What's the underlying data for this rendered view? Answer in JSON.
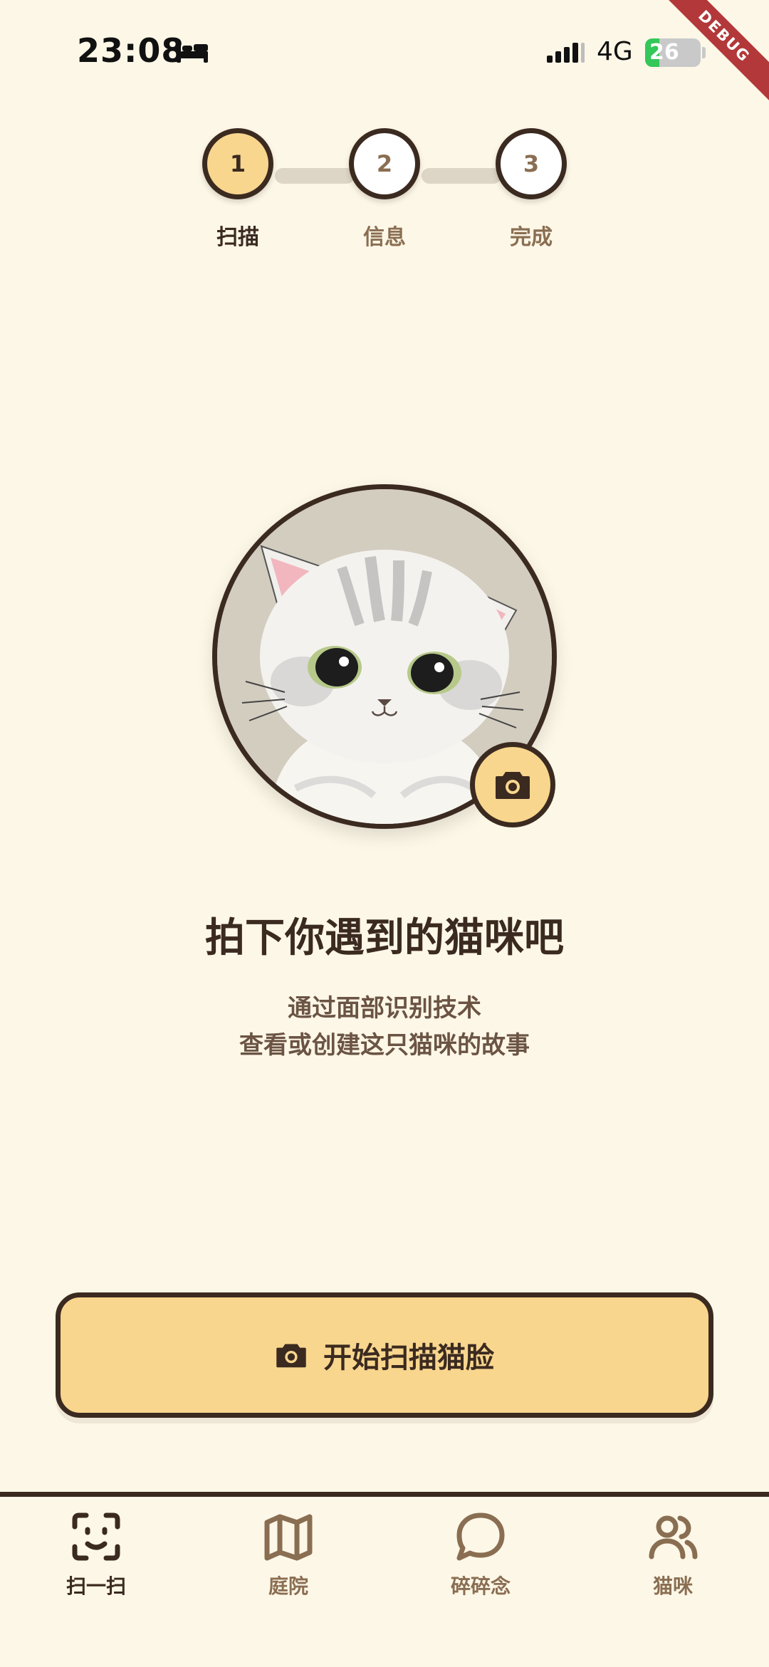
{
  "status_bar": {
    "time": "23:08",
    "network": "4G",
    "battery": "26",
    "battery_level_percent": 26,
    "icons": [
      "bed-icon",
      "signal-icon",
      "battery-icon"
    ]
  },
  "debug_banner": "DEBUG",
  "stepper": {
    "steps": [
      {
        "number": "1",
        "label": "扫描",
        "active": true
      },
      {
        "number": "2",
        "label": "信息",
        "active": false
      },
      {
        "number": "3",
        "label": "完成",
        "active": false
      }
    ]
  },
  "hero": {
    "title": "拍下你遇到的猫咪吧",
    "subtitle_line1": "通过面部识别技术",
    "subtitle_line2": "查看或创建这只猫咪的故事",
    "camera_icon": "camera-icon"
  },
  "primary_button": {
    "label": "开始扫描猫脸",
    "icon": "camera-icon"
  },
  "bottom_nav": {
    "items": [
      {
        "label": "扫一扫",
        "icon": "face-scan-icon",
        "active": true
      },
      {
        "label": "庭院",
        "icon": "map-icon",
        "active": false
      },
      {
        "label": "碎碎念",
        "icon": "chat-bubble-icon",
        "active": false
      },
      {
        "label": "猫咪",
        "icon": "users-icon",
        "active": false
      }
    ]
  },
  "colors": {
    "background": "#FDF7E7",
    "accent": "#F8D68E",
    "outline": "#3B2A20",
    "muted_text": "#8A6E52",
    "battery_green": "#34C759",
    "debug_red": "#B2383A"
  }
}
